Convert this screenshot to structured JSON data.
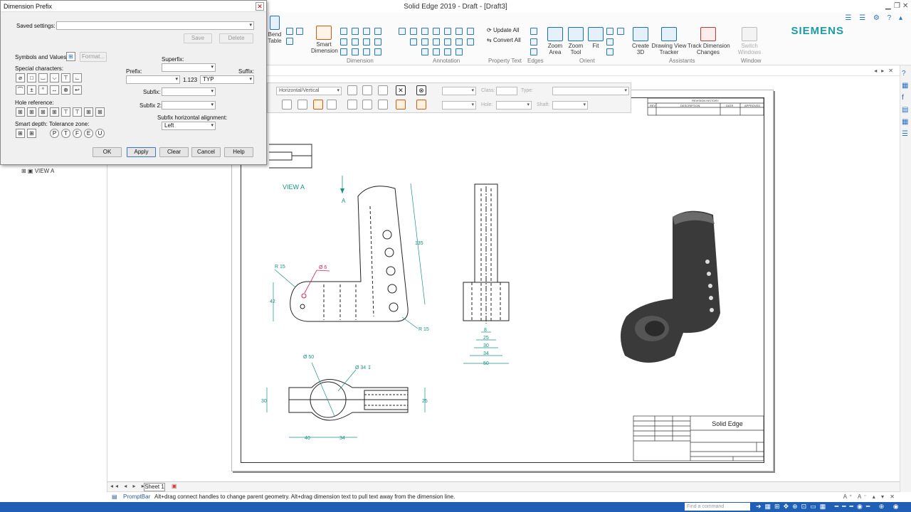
{
  "window": {
    "title": "Solid Edge 2019 - Draft - [Draft3]",
    "brand": "SIEMENS"
  },
  "ribbon": {
    "buttons": {
      "bend_table": "Bend\nTable",
      "smart_dimension": "Smart\nDimension",
      "update_all": "Update All",
      "convert_all": "Convert All",
      "zoom_area": "Zoom\nArea",
      "zoom_tool": "Zoom\nTool",
      "fit": "Fit",
      "create_3d": "Create\n3D",
      "drawing_view_tracker": "Drawing View\nTracker",
      "track_dimension_changes": "Track Dimension\nChanges",
      "switch_windows": "Switch\nWindows"
    },
    "groups": {
      "dimension": "Dimension",
      "annotation": "Annotation",
      "property_text": "Property Text",
      "edges": "Edges",
      "orient": "Orient",
      "assistants": "Assistants",
      "window": "Window"
    }
  },
  "dialog": {
    "title": "Dimension Prefix",
    "saved_settings_label": "Saved settings:",
    "saved_settings_value": "",
    "save_label": "Save",
    "delete_label": "Delete",
    "symbols_values_label": "Symbols and Values:",
    "format_label": "Format...",
    "special_characters_label": "Special characters:",
    "hole_reference_label": "Hole reference:",
    "smart_depth_label": "Smart depth:",
    "tolerance_zone_label": "Tolerance zone:",
    "superfix_label": "Superfix:",
    "prefix_label": "Prefix:",
    "suffix_label": "Suffix:",
    "subfix_label": "Subfix:",
    "subfix2_label": "Subfix 2:",
    "sample_value": "1.123",
    "suffix_value": "TYP",
    "subfix_alignment_label": "Subfix horizontal alignment:",
    "subfix_alignment_value": "Left",
    "ok_label": "OK",
    "apply_label": "Apply",
    "clear_label": "Clear",
    "cancel_label": "Cancel",
    "help_label": "Help"
  },
  "tree": {
    "view_a": "VIEW A"
  },
  "dim_toolbar": {
    "orientation": "Horizontal/Vertical",
    "class_label": "Class:",
    "type_label": "Type:",
    "hole_label": "Hole:",
    "shaft_label": "Shaft:"
  },
  "drawing": {
    "view_label": "VIEW A",
    "arrow_label": "A",
    "dims": {
      "r15a": "R 15",
      "phi6": "Ø 6",
      "d42": "42",
      "d135": "135",
      "r15b": "R 15",
      "phi50": "Ø 50",
      "phi34": "Ø 34 ↧",
      "d30": "30",
      "d25": "25",
      "d40": "40",
      "d34": "34",
      "s8": "8",
      "s25": "25",
      "s30": "30",
      "s34": "34",
      "s50": "50"
    },
    "title_block": {
      "product": "Solid Edge",
      "revision_history": "REVISION HISTORY",
      "rev": "REV",
      "description": "DESCRIPTION",
      "date": "DATE",
      "approved": "APPROVED"
    }
  },
  "tabs": {
    "sheet1": "Sheet 1"
  },
  "prompt": {
    "label": "PromptBar",
    "text": "Alt+drag connect handles to change parent geometry.  Alt+drag dimension text to pull text away from the dimension line."
  },
  "taskbar": {
    "search_placeholder": "Find a command"
  }
}
